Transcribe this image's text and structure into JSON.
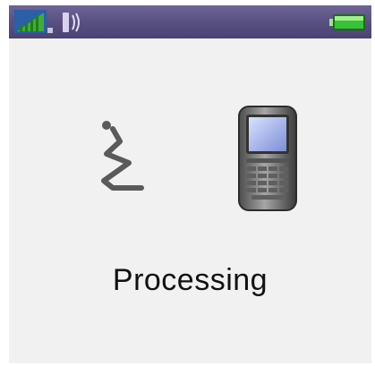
{
  "status_bar": {
    "signal_icon": "signal-strength-icon",
    "vibrate_icon": "vibrate-mode-icon",
    "battery_icon": "battery-full-icon",
    "signal_level": 1.0,
    "battery_level": 1.0,
    "colors": {
      "bar": "#5b5284",
      "signal": "#35a02a",
      "battery": "#3cc23a"
    }
  },
  "content": {
    "left_icon": "voice-input-icon",
    "right_icon": "mobile-phone-icon",
    "status_text": "Processing"
  }
}
